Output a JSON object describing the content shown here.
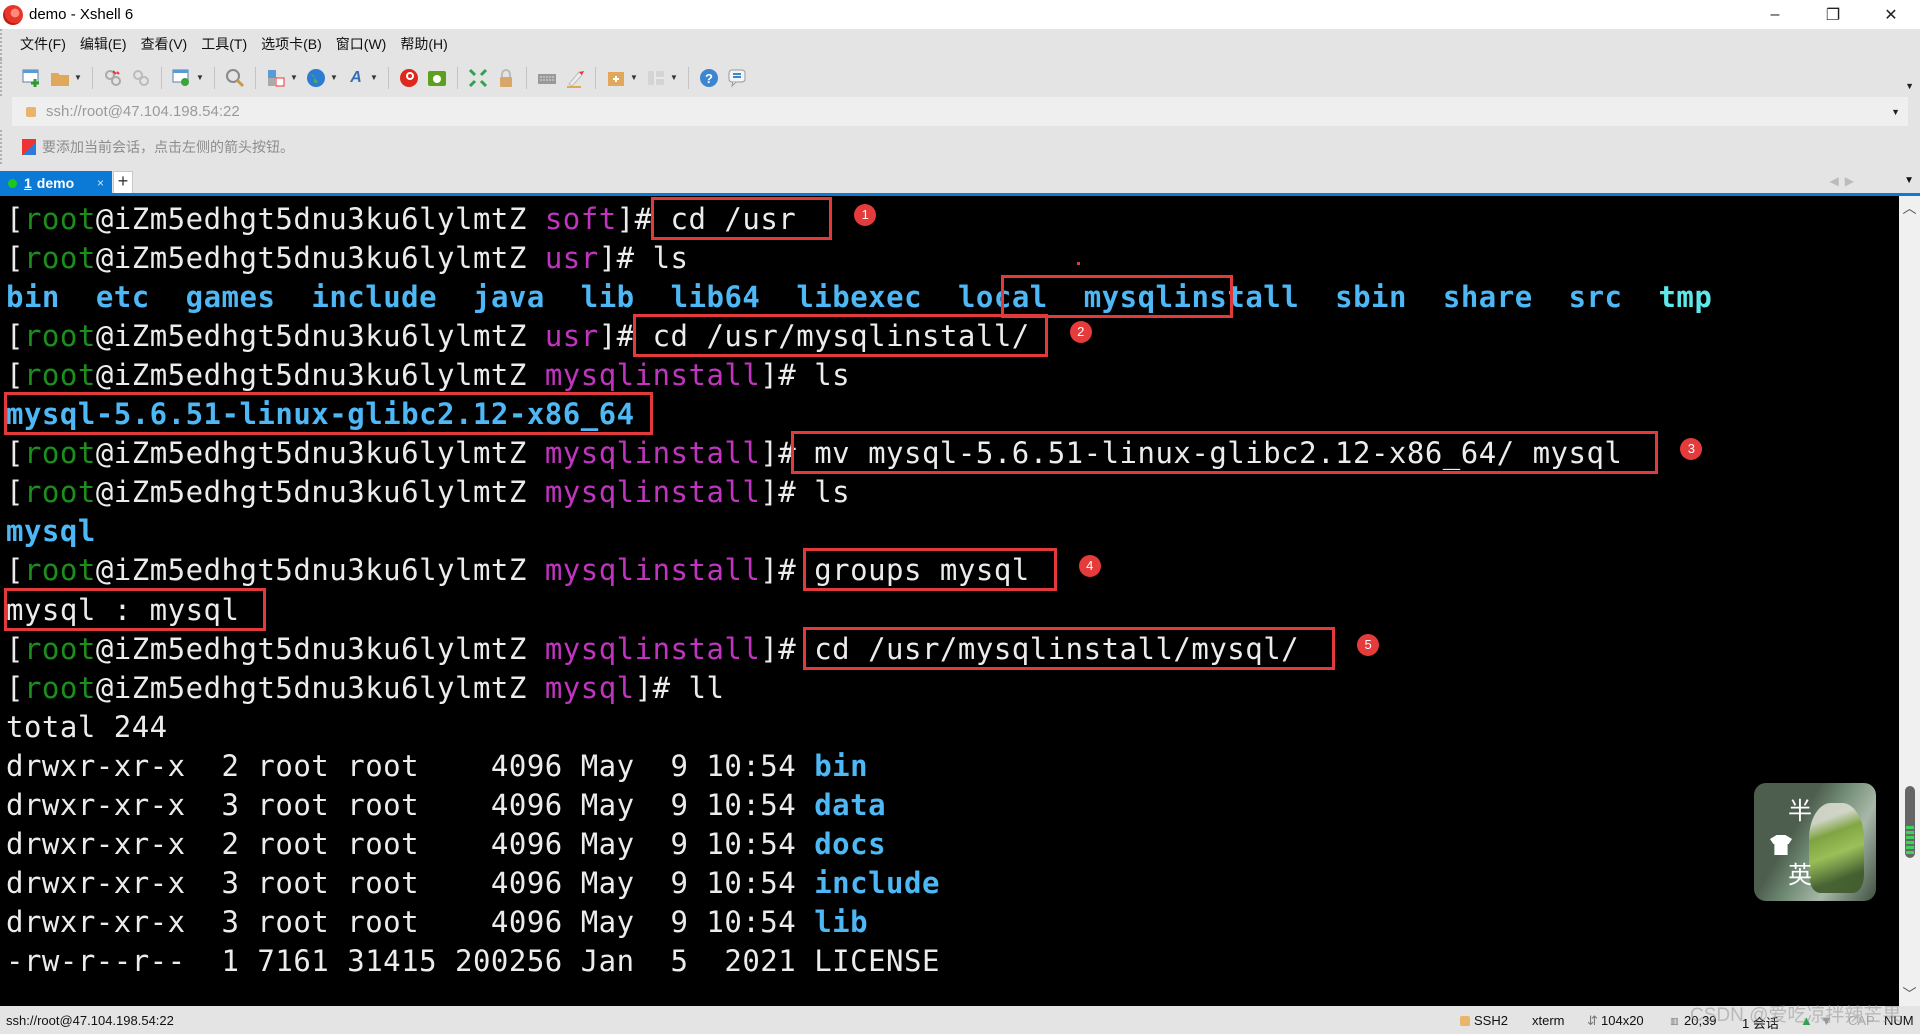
{
  "window": {
    "title": "demo - Xshell 6",
    "minimize_label": "–",
    "restore_label": "❐",
    "close_label": "✕"
  },
  "menu": [
    "文件(F)",
    "编辑(E)",
    "查看(V)",
    "工具(T)",
    "选项卡(B)",
    "窗口(W)",
    "帮助(H)"
  ],
  "toolbar": {
    "icons": [
      "new-session-icon",
      "open-folder-icon",
      "reconnect-icon",
      "disconnect-icon",
      "properties-icon",
      "find-icon",
      "transfer-icon",
      "globe-icon",
      "font-icon",
      "xshell-icon",
      "xftp-icon",
      "fullscreen-icon",
      "lock-icon",
      "keyboard-icon",
      "highlight-icon",
      "new-tab-folder-icon",
      "layout-icon",
      "help-icon",
      "chat-icon"
    ]
  },
  "address": {
    "value": "ssh://root@47.104.198.54:22"
  },
  "hint": {
    "text": "要添加当前会话，点击左侧的箭头按钮。"
  },
  "tabs": [
    {
      "number": "1",
      "label": "demo",
      "active": true,
      "close": "×"
    }
  ],
  "new_tab_label": "+",
  "terminal": {
    "prompt_user": "root",
    "prompt_host": "@iZm5edhgt5dnu3ku6lylmtZ",
    "lines": [
      {
        "type": "prompt",
        "dir": "soft",
        "cmd": "cd /usr"
      },
      {
        "type": "prompt",
        "dir": "usr",
        "cmd": "ls"
      },
      {
        "type": "ls",
        "items": [
          {
            "name": "bin",
            "kind": "dir"
          },
          {
            "name": "etc",
            "kind": "dir"
          },
          {
            "name": "games",
            "kind": "dir"
          },
          {
            "name": "include",
            "kind": "dir"
          },
          {
            "name": "java",
            "kind": "dir"
          },
          {
            "name": "lib",
            "kind": "dir"
          },
          {
            "name": "lib64",
            "kind": "dir"
          },
          {
            "name": "libexec",
            "kind": "dir"
          },
          {
            "name": "local",
            "kind": "dir"
          },
          {
            "name": "mysqlinstall",
            "kind": "dir"
          },
          {
            "name": "sbin",
            "kind": "dir"
          },
          {
            "name": "share",
            "kind": "dir"
          },
          {
            "name": "src",
            "kind": "dir"
          },
          {
            "name": "tmp",
            "kind": "sticky"
          }
        ]
      },
      {
        "type": "prompt",
        "dir": "usr",
        "cmd": "cd /usr/mysqlinstall/"
      },
      {
        "type": "prompt",
        "dir": "mysqlinstall",
        "cmd": "ls"
      },
      {
        "type": "ls",
        "items": [
          {
            "name": "mysql-5.6.51-linux-glibc2.12-x86_64",
            "kind": "dir"
          }
        ]
      },
      {
        "type": "prompt",
        "dir": "mysqlinstall",
        "cmd": "mv mysql-5.6.51-linux-glibc2.12-x86_64/ mysql"
      },
      {
        "type": "prompt",
        "dir": "mysqlinstall",
        "cmd": "ls"
      },
      {
        "type": "ls",
        "items": [
          {
            "name": "mysql",
            "kind": "dir"
          }
        ]
      },
      {
        "type": "prompt",
        "dir": "mysqlinstall",
        "cmd": "groups mysql"
      },
      {
        "type": "text",
        "text": "mysql : mysql"
      },
      {
        "type": "prompt",
        "dir": "mysqlinstall",
        "cmd": "cd /usr/mysqlinstall/mysql/"
      },
      {
        "type": "prompt",
        "dir": "mysql",
        "cmd": "ll"
      },
      {
        "type": "text",
        "text": "total 244"
      },
      {
        "type": "ll",
        "meta": "drwxr-xr-x  2 root root    4096 May  9 10:54 ",
        "name": "bin",
        "kind": "dir"
      },
      {
        "type": "ll",
        "meta": "drwxr-xr-x  3 root root    4096 May  9 10:54 ",
        "name": "data",
        "kind": "dir"
      },
      {
        "type": "ll",
        "meta": "drwxr-xr-x  2 root root    4096 May  9 10:54 ",
        "name": "docs",
        "kind": "dir"
      },
      {
        "type": "ll",
        "meta": "drwxr-xr-x  3 root root    4096 May  9 10:54 ",
        "name": "include",
        "kind": "dir"
      },
      {
        "type": "ll",
        "meta": "drwxr-xr-x  3 root root    4096 May  9 10:54 ",
        "name": "lib",
        "kind": "dir"
      },
      {
        "type": "ll",
        "meta": "-rw-r--r--  1 7161 31415 200256 Jan  5  2021 ",
        "name": "LICENSE",
        "kind": "file"
      }
    ]
  },
  "annotations": [
    {
      "label": "1"
    },
    {
      "label": "2"
    },
    {
      "label": "3"
    },
    {
      "label": "4"
    },
    {
      "label": "5"
    }
  ],
  "widget": {
    "top_char": "半",
    "bottom_char": "英"
  },
  "status": {
    "address": "ssh://root@47.104.198.54:22",
    "protocol": "SSH2",
    "terminal_type": "xterm",
    "size": "104x20",
    "cursor": "20,39",
    "sessions": "1 会话",
    "caps": "CAP",
    "num": "NUM"
  },
  "watermark": "CSDN @爱吃凉拌辣芒果",
  "colors": {
    "accent": "#0a7ad6",
    "prompt_user": "#1b8f1b",
    "prompt_dir": "#c034c0",
    "dir": "#4db8f5",
    "sticky_dir": "#5fe8ea",
    "annotation": "#e23a3a"
  }
}
